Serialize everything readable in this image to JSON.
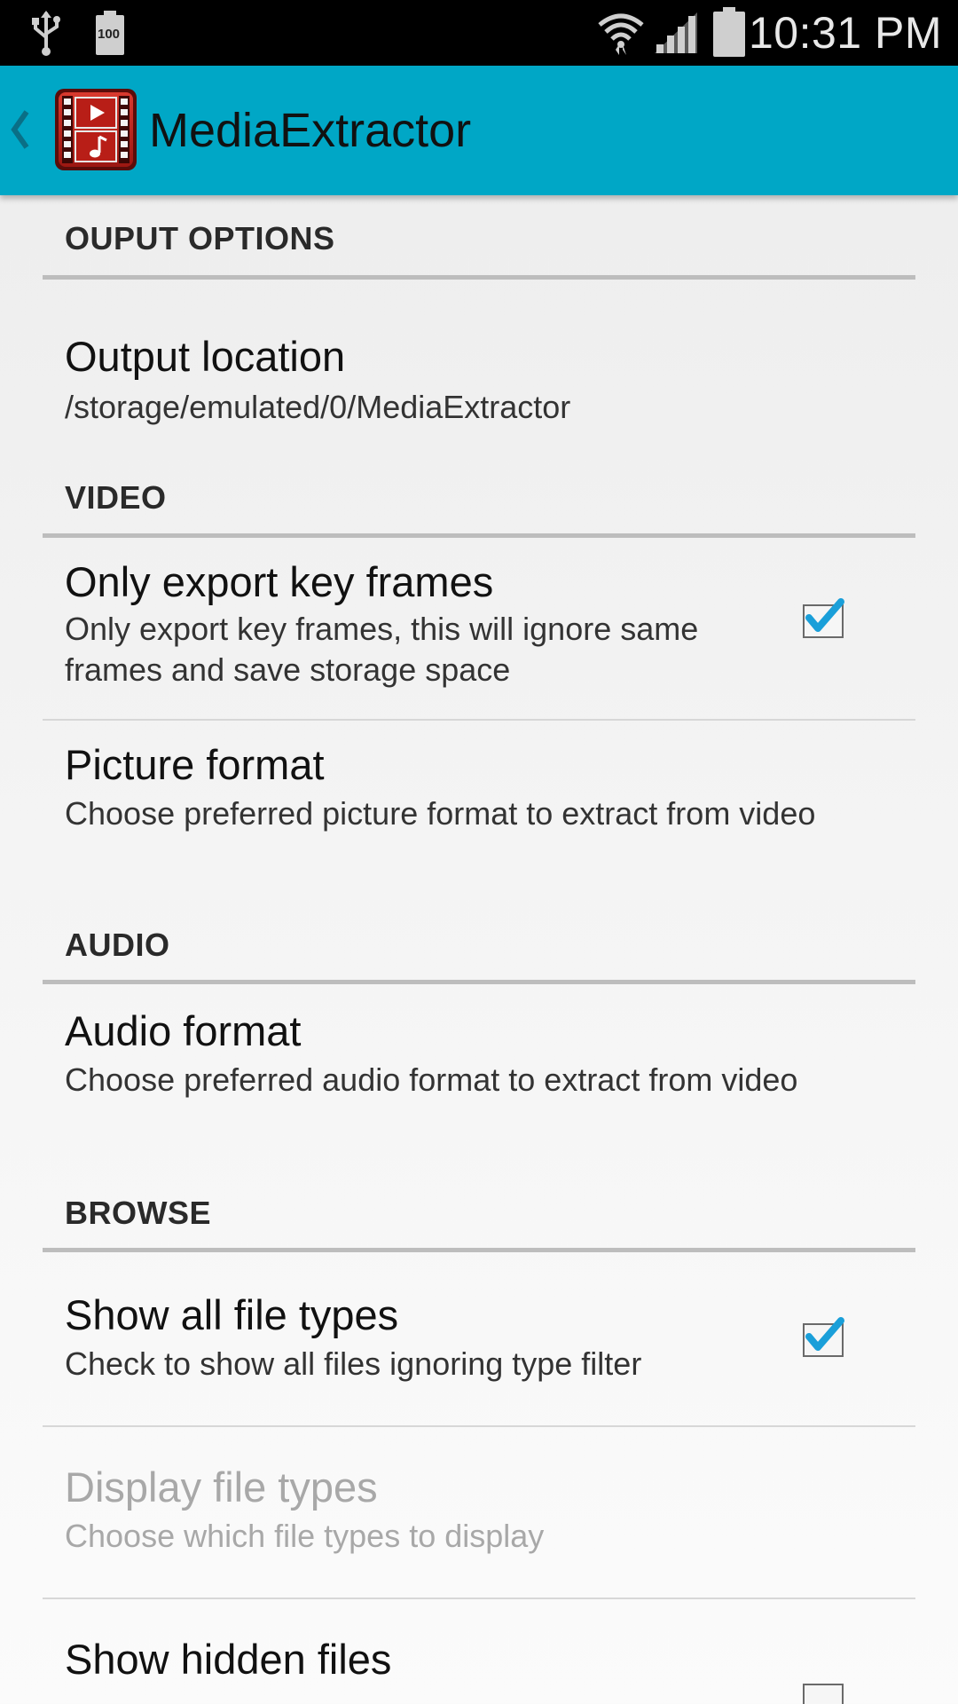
{
  "status_bar": {
    "time": "10:31 PM",
    "battery_level": "100",
    "icons": [
      "usb-icon",
      "battery-icon",
      "wifi-icon",
      "signal-icon",
      "battery-full-icon"
    ]
  },
  "action_bar": {
    "title": "MediaExtractor",
    "back_icon": "chevron-left-icon",
    "app_icon": "film-music-icon",
    "color": "#00a7c6"
  },
  "sections": {
    "output": {
      "header": "OUPUT OPTIONS",
      "output_location": {
        "title": "Output location",
        "summary": "/storage/emulated/0/MediaExtractor"
      }
    },
    "video": {
      "header": "VIDEO",
      "key_frames": {
        "title": "Only export key frames",
        "summary": "Only export key frames, this will ignore same frames and save storage space",
        "checked": true
      },
      "picture_format": {
        "title": "Picture format",
        "summary": "Choose preferred picture format to extract from video"
      }
    },
    "audio": {
      "header": "AUDIO",
      "audio_format": {
        "title": "Audio format",
        "summary": "Choose preferred audio format to extract from video"
      }
    },
    "browse": {
      "header": "BROWSE",
      "show_all_file_types": {
        "title": "Show all file types",
        "summary": "Check to show all files ignoring type filter",
        "checked": true
      },
      "display_file_types": {
        "title": "Display file types",
        "summary": "Choose which file types to display",
        "enabled": false
      },
      "show_hidden_files": {
        "title": "Show hidden files",
        "checked": false
      }
    }
  },
  "colors": {
    "accent": "#00a7c6",
    "check": "#1a9fd9",
    "disabled_text": "#a8a8a8"
  }
}
